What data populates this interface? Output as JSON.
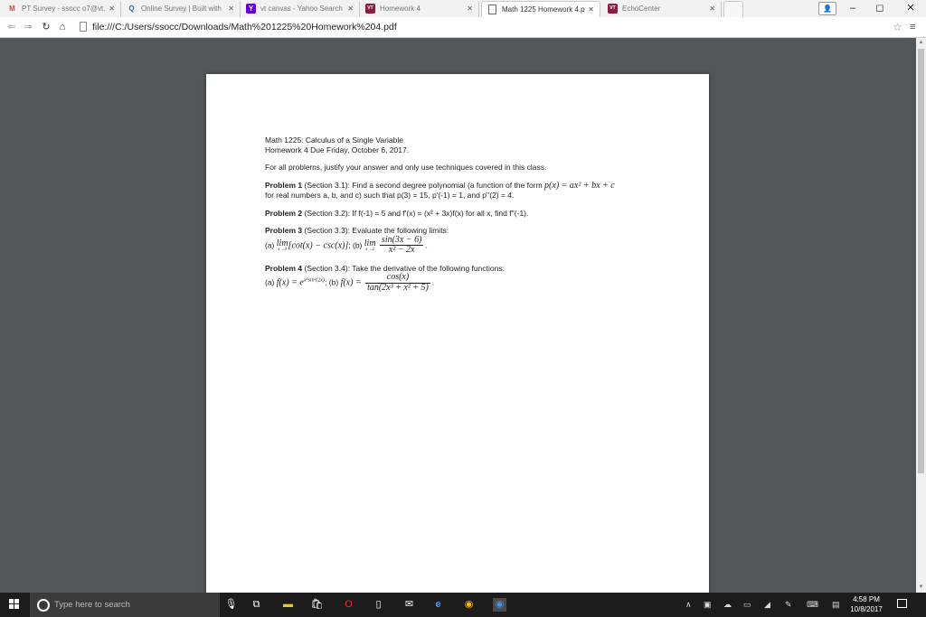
{
  "browser": {
    "tabs": [
      {
        "label": "PT Survey - ssocc o7@vt.",
        "icon": "gmail-icon",
        "icon_char": "M",
        "icon_color": "#d14836"
      },
      {
        "label": "Online Survey | Built with",
        "icon": "qualtrics-icon",
        "icon_char": "Q",
        "icon_color": "#2a6ebb"
      },
      {
        "label": "vt canvas - Yahoo Search",
        "icon": "yahoo-icon",
        "icon_char": "Y",
        "icon_color": "#5f01d1"
      },
      {
        "label": "Homework 4",
        "icon": "vt-icon",
        "icon_char": "VT",
        "icon_color": "#861f41"
      },
      {
        "label": "Math 1225 Homework 4.p",
        "icon": "document-icon",
        "icon_char": "",
        "icon_color": "#555555"
      },
      {
        "label": "EchoCenter",
        "icon": "vt-icon",
        "icon_char": "VT",
        "icon_color": "#861f41"
      }
    ],
    "active_tab": 4,
    "url": "file:///C:/Users/ssocc/Downloads/Math%201225%20Homework%204.pdf",
    "window_controls": {
      "minimize": "–",
      "maximize": "◻",
      "close": "✕"
    }
  },
  "document": {
    "title": "Math 1225: Calculus of a Single Variable",
    "subtitle": "Homework 4 Due Friday, October 6, 2017.",
    "instructions": "For all problems, justify your answer and only use techniques covered in this class.",
    "problems": [
      {
        "label": "Problem 1",
        "section": "(Section 3.1): Find a second degree polynomial (a function of the form",
        "formula": "p(x) = ax² + bx + c",
        "line2": "for real numbers a, b, and c) such that p(3) = 15, p'(-1) = 1, and p''(2) = 4."
      },
      {
        "label": "Problem 2",
        "section": "(Section 3.2): If f(-1) = 5 and f'(x) = (x² + 3x)f(x) for all x, find f''(-1)."
      },
      {
        "label": "Problem 3",
        "section": "(Section 3.3): Evaluate the following limits:",
        "part_a_label": "(a)",
        "part_a_lim": "lim",
        "part_a_sub": "x→0",
        "part_a_expr": "[cot(x) − csc(x)]",
        "part_b_label": "; (b)",
        "part_b_lim": "lim",
        "part_b_sub": "x→2",
        "part_b_num": "sin(3x − 6)",
        "part_b_den": "x² − 2x",
        "end": "."
      },
      {
        "label": "Problem 4",
        "section": "(Section 3.4): Take the derivative of the following functions:",
        "part_a_label": "(a)",
        "part_a_expr": "f(x) = e",
        "part_a_exp": "x⁴sin²(2x)",
        "part_b_label": "; (b)",
        "part_b_lhs": "f(x) =",
        "part_b_num": "cos(x)",
        "part_b_den": "tan(2x³ + x² + 5)",
        "end": "."
      }
    ]
  },
  "taskbar": {
    "search_placeholder": "Type here to search",
    "time": "4:58 PM",
    "date": "10/8/2017"
  }
}
